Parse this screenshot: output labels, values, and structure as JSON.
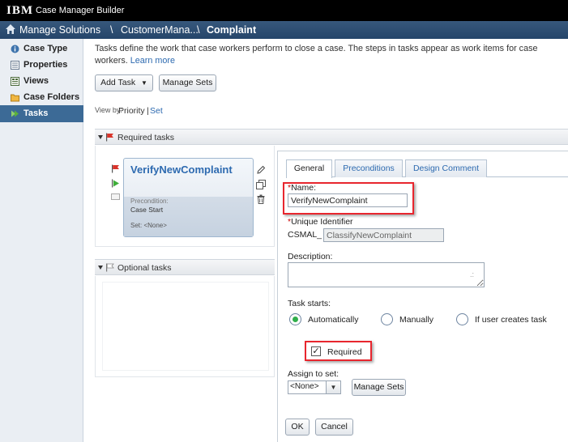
{
  "app": {
    "logo_text": "IBM",
    "title": "Case Manager Builder"
  },
  "breadcrumb": {
    "items": [
      "Manage Solutions",
      "CustomerMana...",
      "Complaint"
    ],
    "separator": "\\"
  },
  "sidebar": {
    "items": [
      {
        "label": "Case Type",
        "icon": "info-icon"
      },
      {
        "label": "Properties",
        "icon": "properties-icon"
      },
      {
        "label": "Views",
        "icon": "views-icon"
      },
      {
        "label": "Case Folders",
        "icon": "folder-icon"
      },
      {
        "label": "Tasks",
        "icon": "tasks-icon",
        "active": true
      }
    ]
  },
  "main": {
    "intro_text": "Tasks define the work that case workers perform to close a case. The steps in tasks appear as work items for case workers.",
    "learn_more": "Learn more",
    "add_task_label": "Add Task",
    "manage_sets_label": "Manage Sets",
    "view_by_label": "View by:",
    "view_by_priority": "Priority",
    "view_by_sep": "|",
    "view_by_set": "Set",
    "required_tasks_label": "Required tasks",
    "optional_tasks_label": "Optional tasks"
  },
  "task_card": {
    "name": "VerifyNewComplaint",
    "precondition_label": "Precondition:",
    "precondition_value": "Case Start",
    "set_text": "Set: <None>"
  },
  "details": {
    "tabs": [
      "General",
      "Preconditions",
      "Design Comment"
    ],
    "active_tab": "General",
    "name_label": "Name:",
    "name_value": "VerifyNewComplaint",
    "uid_label": "Unique Identifier",
    "uid_prefix": "CSMAL_",
    "uid_value": "ClassifyNewComplaint",
    "description_label": "Description:",
    "description_value": "",
    "task_starts_label": "Task starts:",
    "task_starts_options": [
      "Automatically",
      "Manually",
      "If user creates task"
    ],
    "task_starts_selected": "Automatically",
    "required_label": "Required",
    "required_checked": true,
    "assign_to_set_label": "Assign to set:",
    "assign_to_set_value": "<None>",
    "manage_sets_label": "Manage Sets",
    "ok_label": "OK",
    "cancel_label": "Cancel"
  },
  "colors": {
    "titlebar": "#000000",
    "breadcrumb_bar": "#2e4f75",
    "active_nav": "#3c6a96",
    "link": "#2d6ab0",
    "highlight": "#e8262e",
    "radio_selected": "#2fae4a"
  }
}
